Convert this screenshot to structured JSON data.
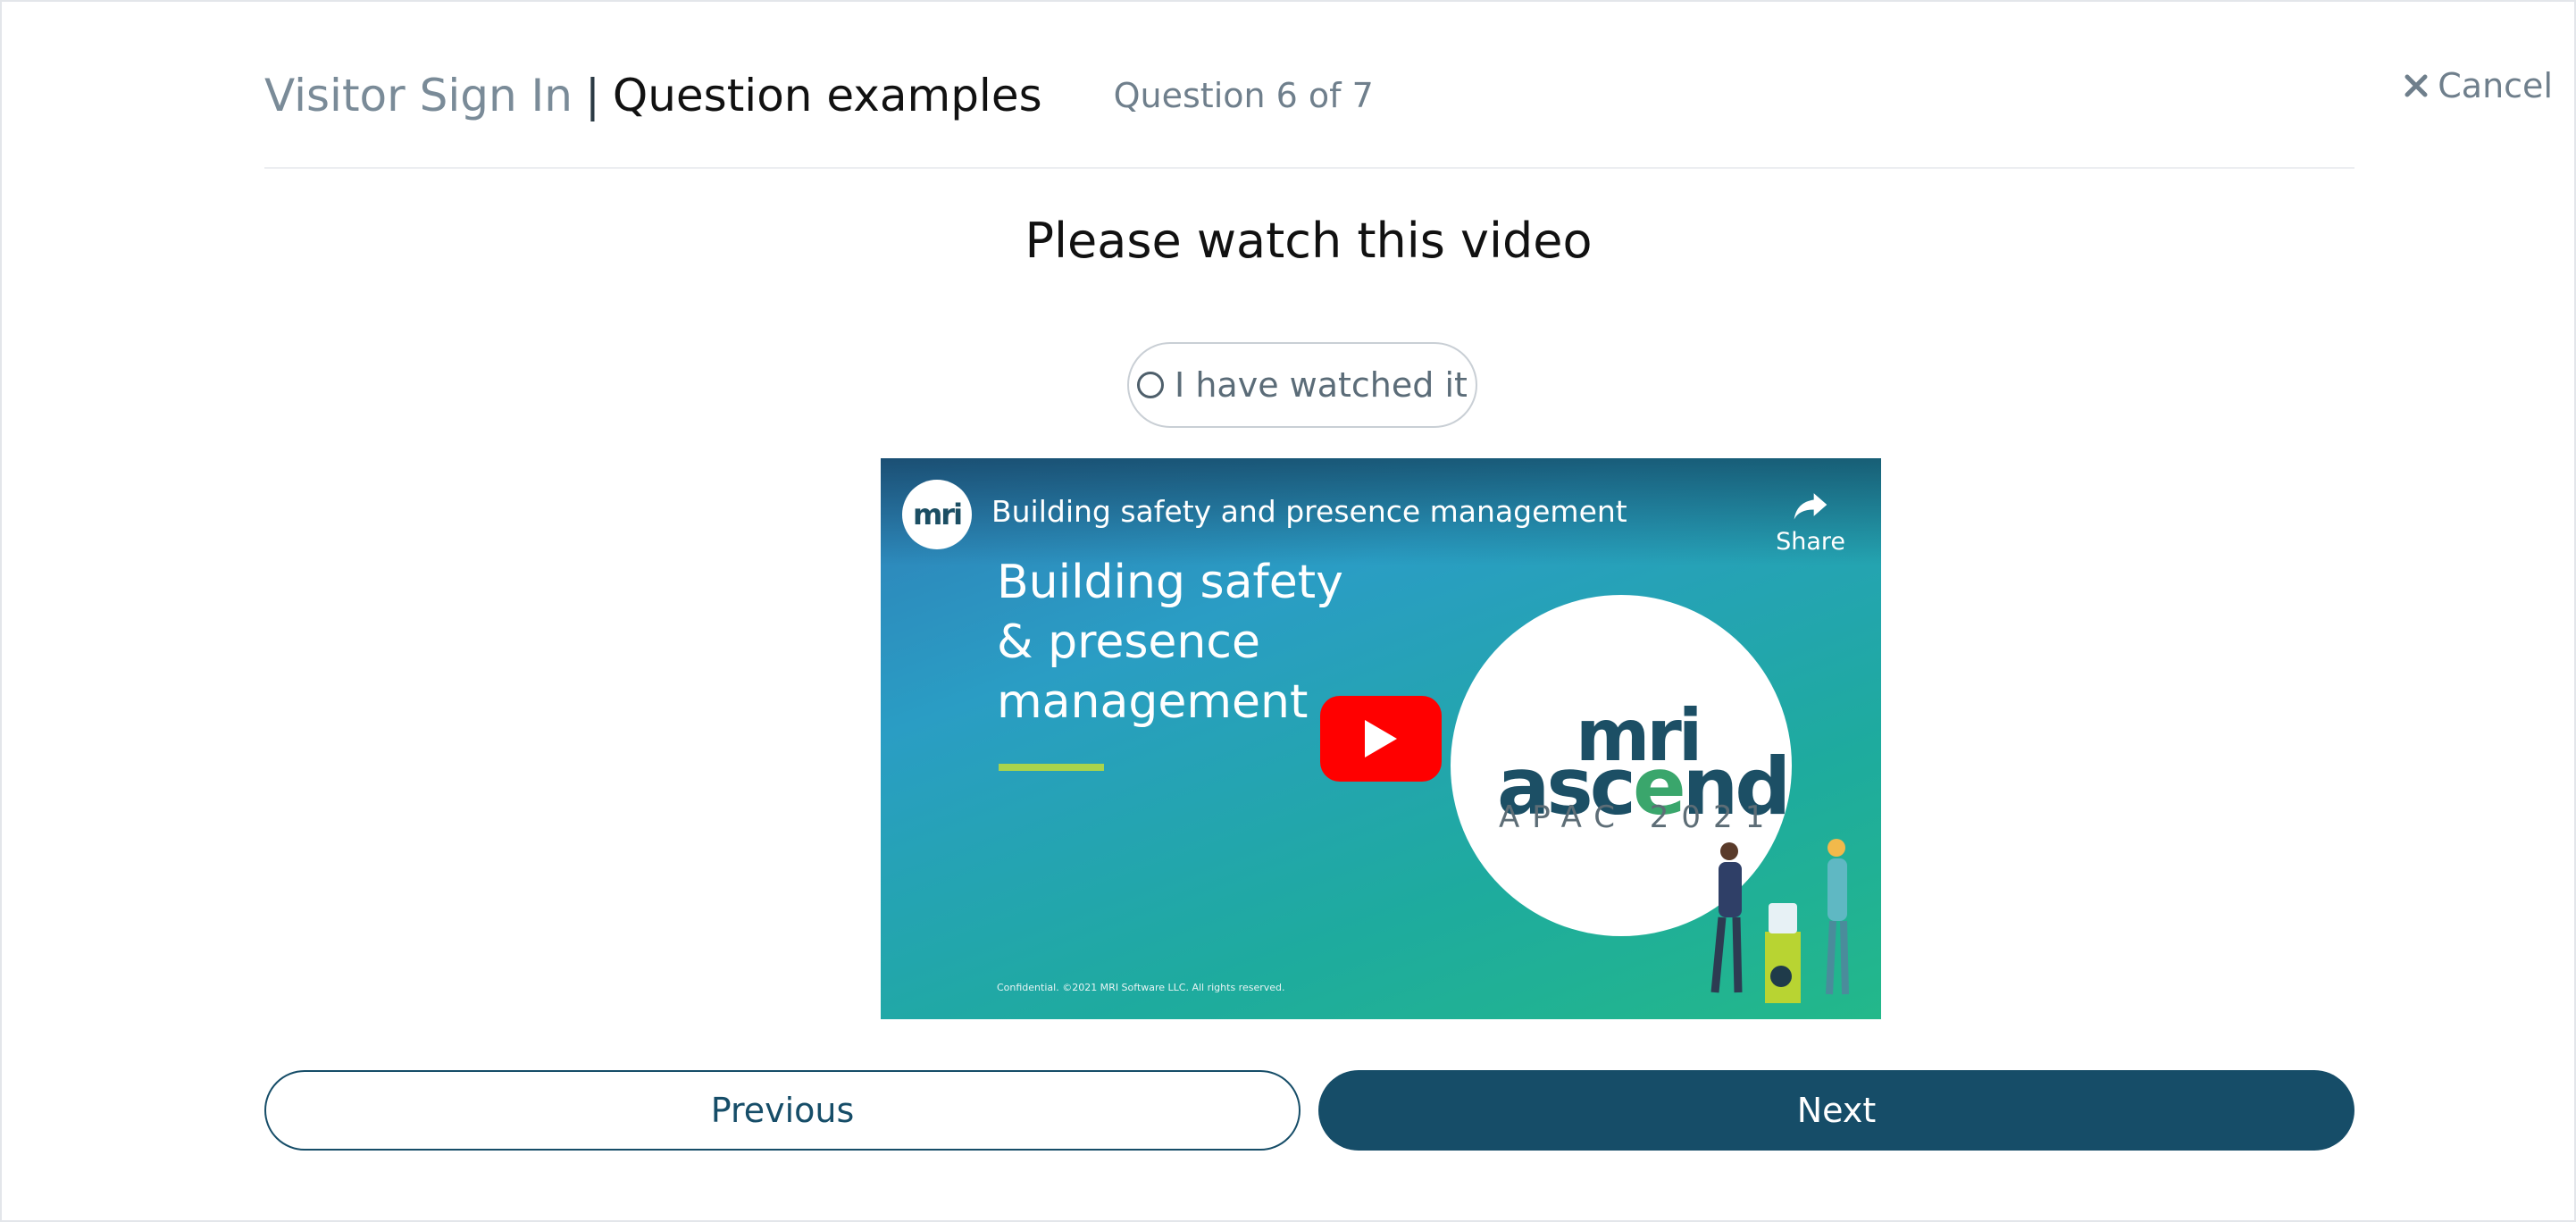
{
  "header": {
    "app_name": "Visitor Sign In",
    "separator": "|",
    "page_title": "Question examples",
    "progress": "Question 6 of 7",
    "cancel_label": "Cancel"
  },
  "question": {
    "prompt": "Please watch this video",
    "confirm_label": "I have watched it",
    "confirm_checked": false
  },
  "video": {
    "channel_logo_text": "mri",
    "title": "Building safety and presence management",
    "share_label": "Share",
    "slide_title": "Building safety & presence management",
    "logo_mri": "mri",
    "logo_ascend_pre": "asc",
    "logo_ascend_accent": "e",
    "logo_ascend_post": "nd",
    "logo_subtitle": "APAC 2021",
    "footer_note": "Confidential. ©2021 MRI Software LLC. All rights reserved.",
    "icons": [
      "share-icon",
      "play-icon"
    ]
  },
  "navigation": {
    "previous_label": "Previous",
    "next_label": "Next"
  },
  "colors": {
    "primary": "#164d68",
    "muted_text": "#6f7f8c",
    "youtube_red": "#ff0000",
    "accent_green": "#a9d44c"
  }
}
